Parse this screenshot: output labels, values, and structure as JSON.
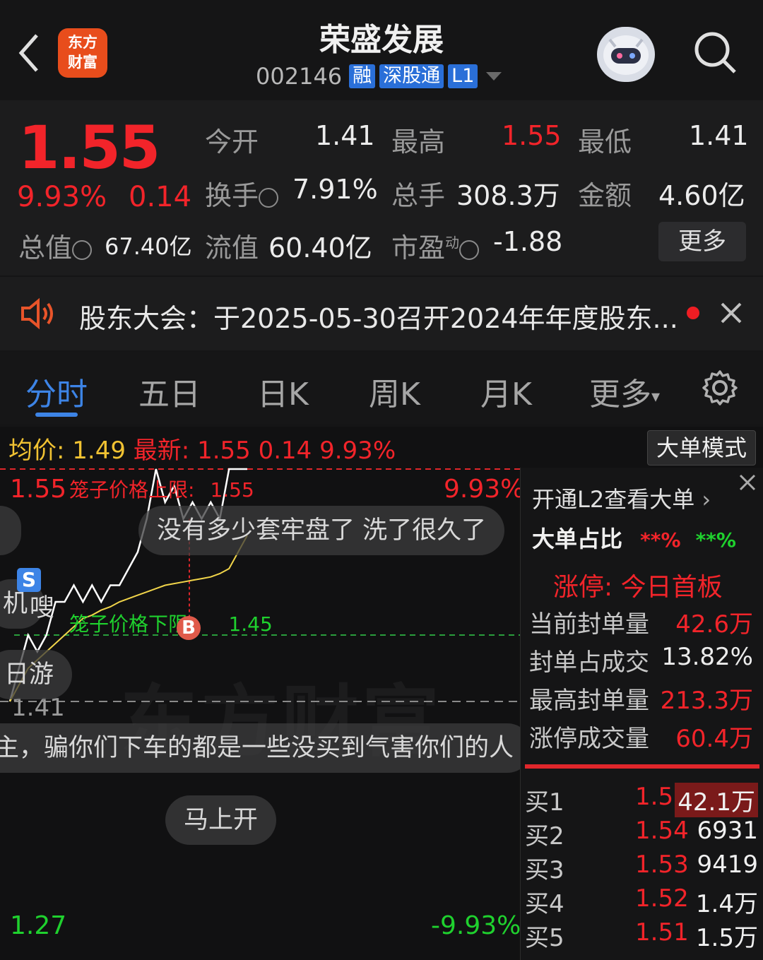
{
  "header": {
    "title": "荣盛发展",
    "code": "002146",
    "tags": [
      "融",
      "深股通",
      "L1"
    ],
    "logo_text": "东方财富"
  },
  "quote": {
    "price": "1.55",
    "change_pct": "9.93%",
    "change": "0.14",
    "total_value_label": "总值",
    "total_value": "67.40亿",
    "fields": [
      {
        "label": "今开",
        "value": "1.41"
      },
      {
        "label": "最高",
        "value": "1.55"
      },
      {
        "label": "最低",
        "value": "1.41"
      },
      {
        "label": "换手",
        "value": "7.91%"
      },
      {
        "label": "总手",
        "value": "308.3万"
      },
      {
        "label": "金额",
        "value": "4.60亿"
      },
      {
        "label": "流值",
        "value": "60.40亿"
      },
      {
        "label": "市盈",
        "value": "-1.88"
      }
    ],
    "pe_sup": "动",
    "more_label": "更多"
  },
  "notice": {
    "text": "股东大会：于2025-05-30召开2024年年度股东..."
  },
  "tabs": [
    "分时",
    "五日",
    "日K",
    "周K",
    "月K",
    "更多"
  ],
  "chart_header": {
    "avg_label": "均价:",
    "avg_value": "1.49",
    "latest_label": "最新:",
    "latest_value": "1.55",
    "latest_change": "0.14",
    "latest_pct": "9.93%",
    "mode_button": "大单模式"
  },
  "chart_labels": {
    "top_price": "1.55",
    "upper_limit_text": "笼子价格上限:",
    "upper_limit_value": "1.55",
    "top_pct": "9.93%",
    "lower_limit_text": "笼子价格下限:",
    "lower_limit_value": "1.45",
    "mid_price": "1.41",
    "bottom_price": "1.27",
    "bottom_pct": "-9.93%",
    "watermark": "东方财富",
    "marker_s": "S",
    "marker_b": "B"
  },
  "danmaku": [
    "没有多少套牢盘了 洗了很久了",
    "机",
    "嗖",
    "日游",
    "主，骗你们下车的都是一些没买到气害你们的人",
    "马上开"
  ],
  "panel": {
    "l2_link": "开通L2查看大单",
    "big_ratio_label": "大单占比",
    "big_ratio_buy": "**%",
    "big_ratio_sell": "**%",
    "limit_title": "涨停:  今日首板",
    "stats": [
      {
        "label": "当前封单量",
        "value": "42.6万",
        "color": "red"
      },
      {
        "label": "封单占成交",
        "value": "13.82%",
        "color": "white"
      },
      {
        "label": "最高封单量",
        "value": "213.3万",
        "color": "red"
      },
      {
        "label": "涨停成交量",
        "value": "60.4万",
        "color": "red"
      }
    ],
    "bids": [
      {
        "label": "买1",
        "price": "1.55",
        "vol": "42.1万"
      },
      {
        "label": "买2",
        "price": "1.54",
        "vol": "6931"
      },
      {
        "label": "买3",
        "price": "1.53",
        "vol": "9419"
      },
      {
        "label": "买4",
        "price": "1.52",
        "vol": "1.4万"
      },
      {
        "label": "买5",
        "price": "1.51",
        "vol": "1.5万"
      }
    ]
  },
  "chart_data": {
    "type": "line",
    "ylim": [
      1.27,
      1.55
    ],
    "series": [
      {
        "values": [
          1.41,
          1.43,
          1.45,
          1.44,
          1.45,
          1.47,
          1.47,
          1.48,
          1.47,
          1.48,
          1.47,
          1.48,
          1.48,
          1.49,
          1.5,
          1.52,
          1.55,
          1.53,
          1.54,
          1.52,
          1.53,
          1.52,
          1.53,
          1.52,
          1.55,
          1.55,
          1.55
        ]
      },
      {
        "values": [
          1.41,
          1.42,
          1.43,
          1.435,
          1.44,
          1.445,
          1.45,
          1.455,
          1.46,
          1.462,
          1.465,
          1.467,
          1.47,
          1.472,
          1.474,
          1.476,
          1.478,
          1.48,
          1.481,
          1.482,
          1.483,
          1.484,
          1.485,
          1.487,
          1.49,
          1.5,
          1.51
        ]
      }
    ],
    "colors": {
      "price": "#ffffff",
      "avg": "#f1d54a",
      "upper": "#e0262b",
      "lower": "#2a9e3c"
    }
  }
}
